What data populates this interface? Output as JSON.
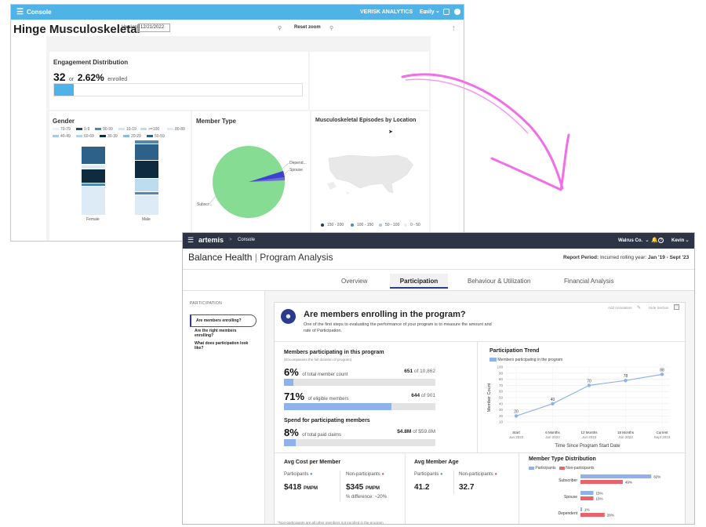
{
  "old_console": {
    "app_title": "Console",
    "brand": "VERISK ANALYTICS",
    "user": "Emily",
    "page_title": "Hinge Musculoskeletal",
    "version_label": "Version:",
    "version_value": "12/21/2022",
    "reset_zoom": "Reset zoom",
    "engagement": {
      "title": "Engagement Distribution",
      "count": "32",
      "or": "or",
      "percent": "2.62%",
      "suffix": "enrolled",
      "progress_fraction": 0.0262
    },
    "gender": {
      "title": "Gender",
      "legend": [
        "70-79",
        "0-9",
        "90-99",
        "10-19",
        ">=100",
        "80-89",
        "40-49",
        "60-69",
        "30-39",
        "20-29",
        "50-59"
      ],
      "categories": [
        "Female",
        "Male"
      ]
    },
    "member_type": {
      "title": "Member Type",
      "labels": [
        "Depend...",
        "Spouse",
        "Subscr..."
      ],
      "fractions": [
        0.03,
        0.02,
        0.95
      ]
    },
    "map": {
      "title": "Musculoskeletal Episodes by Location",
      "legend": [
        "150 - 200",
        "100 - 150",
        "50 - 100",
        "0 - 50"
      ]
    }
  },
  "new_app": {
    "logo": "artemis",
    "console": "Console",
    "org": "Walrus Co.",
    "user": "Kevin",
    "title_main": "Balance Health",
    "title_sub": "Program Analysis",
    "period_label": "Report Period:",
    "period_text": "Incurred rolling year:",
    "period_value": "Jan '19 - Sept '23",
    "tabs": [
      "Overview",
      "Participation",
      "Behaviour & Utilization",
      "Financial Analysis"
    ],
    "sidebar": {
      "heading": "PARTICIPATION",
      "items": [
        "Are members enrolling?",
        "Are the right members enrolling?",
        "What does participation look like?"
      ]
    },
    "panel": {
      "add_annotation": "Add Annotation",
      "hide_section": "Hide Section",
      "question": "Are members enrolling in the program?",
      "description": "One of the first steps to evaluating the performance of your program is to measure the amount and rate of Participation."
    },
    "participating": {
      "title": "Members participating in this program",
      "subtitle": "(Encompasses the full duration of program)",
      "rows": [
        {
          "pct": "6%",
          "text": "of total member count",
          "value": "651",
          "of": "of 10,862",
          "fraction": 0.06
        },
        {
          "pct": "71%",
          "text": "of eligible members",
          "value": "644",
          "of": "of 901",
          "fraction": 0.71
        }
      ],
      "spend_title": "Spend for participating members",
      "spend": {
        "pct": "8%",
        "text": "of total paid claims",
        "value": "$4.8M",
        "of": "of $59.8M",
        "fraction": 0.08
      }
    },
    "trend": {
      "title": "Participation Trend",
      "legend": "Members participating in the program",
      "ylabel": "Member Count",
      "xlabel": "Time Since Program Start Date",
      "chart_data": {
        "type": "line",
        "categories": [
          "Start",
          "6 Months",
          "12 Months",
          "18 Months",
          "Current"
        ],
        "sublabels": [
          "Jun 2022",
          "Jun 2022",
          "Jun 2023",
          "Jun 2023",
          "Sept 2023"
        ],
        "values": [
          20,
          40,
          70,
          78,
          88
        ],
        "yticks": [
          10,
          20,
          30,
          40,
          50,
          60,
          70,
          80,
          90,
          100
        ],
        "ylim": [
          0,
          100
        ],
        "color": "#8fb2ec"
      }
    },
    "cost": {
      "title": "Avg Cost per Member",
      "participants_label": "Participants",
      "non_label": "Non-participants",
      "participants_value": "$418",
      "non_value": "$345",
      "unit": "PMPM",
      "diff": "% difference: ~20%"
    },
    "age": {
      "title": "Avg Member Age",
      "participants_label": "Participants",
      "non_label": "Non-participants",
      "participants_value": "41.2",
      "non_value": "32.7"
    },
    "member_type": {
      "title": "Member Type Distribution",
      "legend": [
        "Participants",
        "Non-participants"
      ],
      "chart_data": {
        "type": "bar",
        "categories": [
          "Subscriber",
          "Spouse",
          "Dependent"
        ],
        "series": [
          {
            "name": "Participants",
            "values": [
              82,
              15,
              1
            ]
          },
          {
            "name": "Non-participants",
            "values": [
              49,
              15,
              28
            ]
          }
        ],
        "value_labels": [
          [
            "82%",
            "15%",
            "1%"
          ],
          [
            "49%",
            "15%",
            "28%"
          ]
        ],
        "colors": [
          "#8fb2ec",
          "#e8636b"
        ]
      }
    },
    "footnote": "*Non-participants are all other members not enrolled in the program"
  }
}
